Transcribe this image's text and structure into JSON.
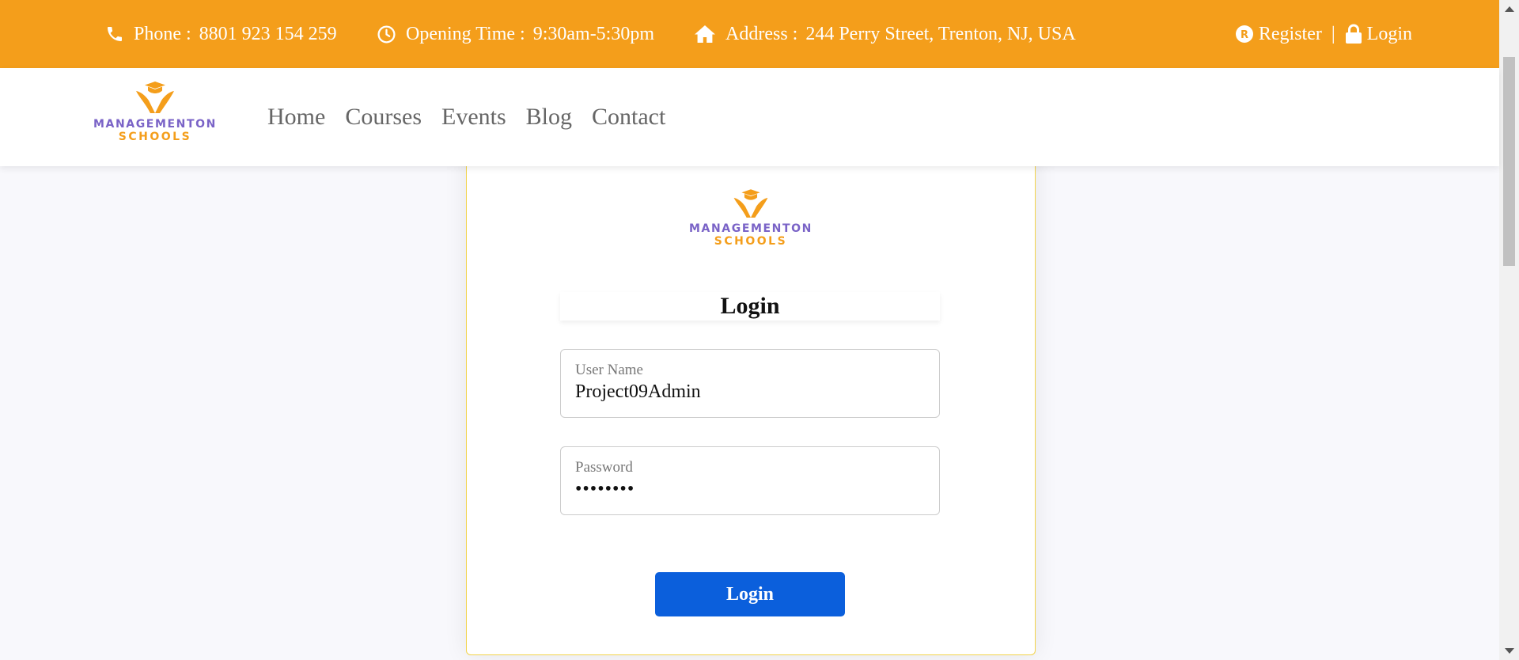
{
  "topbar": {
    "phone_label": "Phone :",
    "phone_value": "8801 923 154 259",
    "hours_label": "Opening Time :",
    "hours_value": "9:30am-5:30pm",
    "address_label": "Address :",
    "address_value": "244 Perry Street, Trenton, NJ, USA",
    "register_label": "Register",
    "separator": "|",
    "login_label": "Login",
    "color": "#f49e1b"
  },
  "brand": {
    "line1": "MANAGEMENTON",
    "line2": "SCHOOLS",
    "primary_color": "#7a63c7",
    "accent_color": "#f49e1b"
  },
  "nav": {
    "items": [
      {
        "label": "Home"
      },
      {
        "label": "Courses"
      },
      {
        "label": "Events"
      },
      {
        "label": "Blog"
      },
      {
        "label": "Contact"
      }
    ]
  },
  "login_form": {
    "title": "Login",
    "username_label": "User Name",
    "username_value": "Project09Admin",
    "password_label": "Password",
    "password_value": "••••••••",
    "submit_label": "Login",
    "button_color": "#0b5fdc",
    "card_border_color": "#f2d34a"
  },
  "icons": {
    "phone": "phone-icon",
    "clock": "clock-icon",
    "home": "home-icon",
    "register": "registered-icon",
    "login": "lock-icon"
  }
}
